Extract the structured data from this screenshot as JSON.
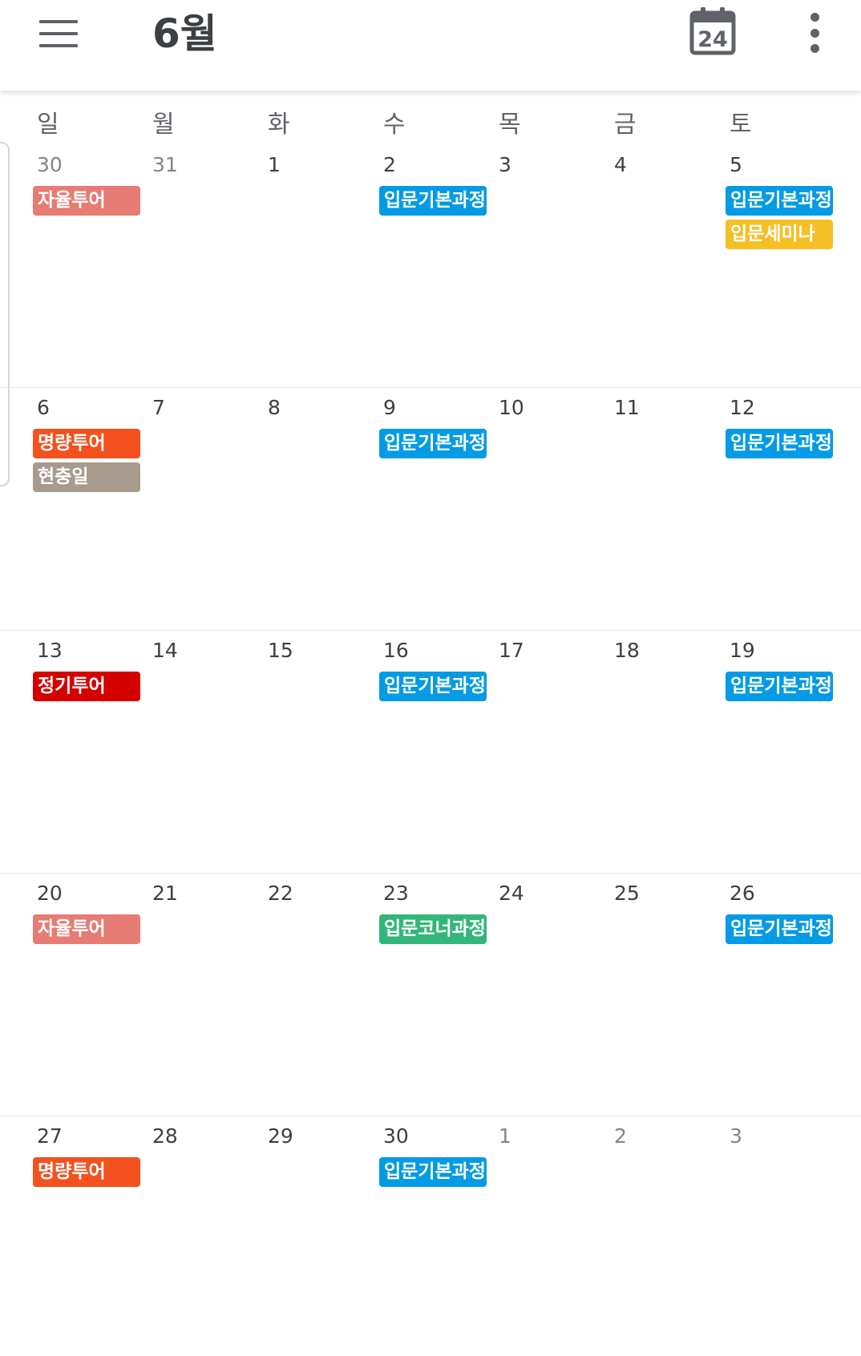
{
  "header": {
    "title": "6월",
    "today_icon_day": "24",
    "icons": {
      "menu": "hamburger-menu-icon",
      "today": "calendar-today-icon",
      "more": "more-vert-icon"
    }
  },
  "colors": {
    "blue": "#039be5",
    "yellow": "#f6bf26",
    "salmon": "#e67c73",
    "orange": "#f4511e",
    "gray": "#a79b8e",
    "red": "#d50000",
    "green": "#33b679"
  },
  "weekdays": [
    "일",
    "월",
    "화",
    "수",
    "목",
    "금",
    "토"
  ],
  "weeks": [
    {
      "days": [
        {
          "num": "30",
          "muted": true,
          "events": [
            {
              "title": "자율투어",
              "color": "#e67c73"
            }
          ]
        },
        {
          "num": "31",
          "muted": true,
          "events": []
        },
        {
          "num": "1",
          "muted": false,
          "events": []
        },
        {
          "num": "2",
          "muted": false,
          "events": [
            {
              "title": "입문기본과정",
              "color": "#039be5"
            }
          ]
        },
        {
          "num": "3",
          "muted": false,
          "events": []
        },
        {
          "num": "4",
          "muted": false,
          "events": []
        },
        {
          "num": "5",
          "muted": false,
          "events": [
            {
              "title": "입문기본과정",
              "color": "#039be5"
            },
            {
              "title": "입문세미나",
              "color": "#f6bf26"
            }
          ]
        }
      ]
    },
    {
      "days": [
        {
          "num": "6",
          "muted": false,
          "events": [
            {
              "title": "명량투어",
              "color": "#f4511e"
            },
            {
              "title": "현충일",
              "color": "#a79b8e"
            }
          ]
        },
        {
          "num": "7",
          "muted": false,
          "events": []
        },
        {
          "num": "8",
          "muted": false,
          "events": []
        },
        {
          "num": "9",
          "muted": false,
          "events": [
            {
              "title": "입문기본과정",
              "color": "#039be5"
            }
          ]
        },
        {
          "num": "10",
          "muted": false,
          "events": []
        },
        {
          "num": "11",
          "muted": false,
          "events": []
        },
        {
          "num": "12",
          "muted": false,
          "events": [
            {
              "title": "입문기본과정",
              "color": "#039be5"
            }
          ]
        }
      ]
    },
    {
      "days": [
        {
          "num": "13",
          "muted": false,
          "events": [
            {
              "title": "정기투어",
              "color": "#d50000"
            }
          ]
        },
        {
          "num": "14",
          "muted": false,
          "events": []
        },
        {
          "num": "15",
          "muted": false,
          "events": []
        },
        {
          "num": "16",
          "muted": false,
          "events": [
            {
              "title": "입문기본과정",
              "color": "#039be5"
            }
          ]
        },
        {
          "num": "17",
          "muted": false,
          "events": []
        },
        {
          "num": "18",
          "muted": false,
          "events": []
        },
        {
          "num": "19",
          "muted": false,
          "events": [
            {
              "title": "입문기본과정",
              "color": "#039be5"
            }
          ]
        }
      ]
    },
    {
      "days": [
        {
          "num": "20",
          "muted": false,
          "events": [
            {
              "title": "자율투어",
              "color": "#e67c73"
            }
          ]
        },
        {
          "num": "21",
          "muted": false,
          "events": []
        },
        {
          "num": "22",
          "muted": false,
          "events": []
        },
        {
          "num": "23",
          "muted": false,
          "events": [
            {
              "title": "입문코너과정",
              "color": "#33b679"
            }
          ]
        },
        {
          "num": "24",
          "muted": false,
          "events": []
        },
        {
          "num": "25",
          "muted": false,
          "events": []
        },
        {
          "num": "26",
          "muted": false,
          "events": [
            {
              "title": "입문기본과정",
              "color": "#039be5"
            }
          ]
        }
      ]
    },
    {
      "days": [
        {
          "num": "27",
          "muted": false,
          "events": [
            {
              "title": "명량투어",
              "color": "#f4511e"
            }
          ]
        },
        {
          "num": "28",
          "muted": false,
          "events": []
        },
        {
          "num": "29",
          "muted": false,
          "events": []
        },
        {
          "num": "30",
          "muted": false,
          "events": [
            {
              "title": "입문기본과정",
              "color": "#039be5"
            }
          ]
        },
        {
          "num": "1",
          "muted": true,
          "events": []
        },
        {
          "num": "2",
          "muted": true,
          "events": []
        },
        {
          "num": "3",
          "muted": true,
          "events": []
        }
      ]
    }
  ]
}
